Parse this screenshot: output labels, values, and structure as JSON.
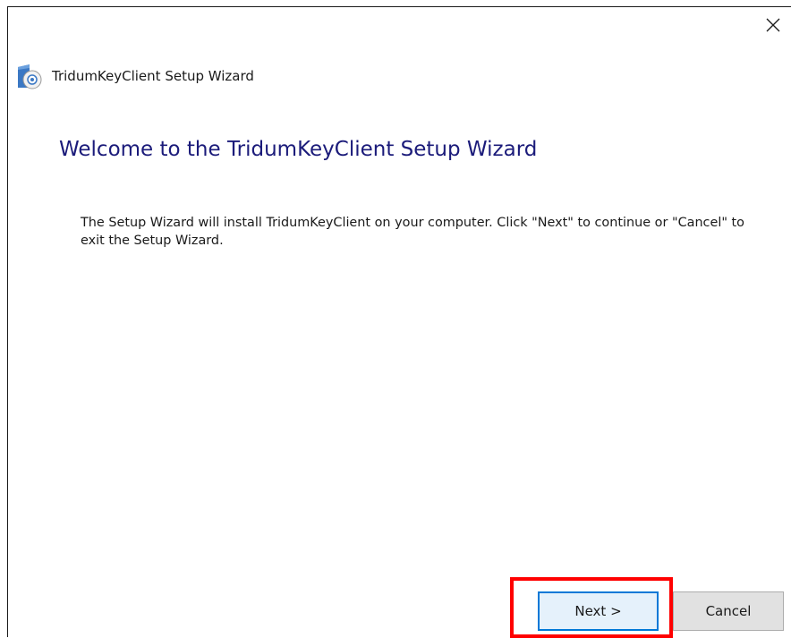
{
  "window": {
    "title": "TridumKeyClient Setup Wizard",
    "close_glyph": "✕"
  },
  "content": {
    "heading": "Welcome to the TridumKeyClient Setup Wizard",
    "description": "The Setup Wizard will install TridumKeyClient on your computer.  Click \"Next\" to continue or \"Cancel\" to exit the Setup Wizard."
  },
  "buttons": {
    "next_label": "Next >",
    "cancel_label": "Cancel"
  },
  "colors": {
    "heading": "#1b1b7a",
    "highlight": "#ff0000",
    "focus_border": "#0078d7"
  },
  "icons": {
    "app": "setup-disc-icon",
    "close": "close-icon"
  }
}
